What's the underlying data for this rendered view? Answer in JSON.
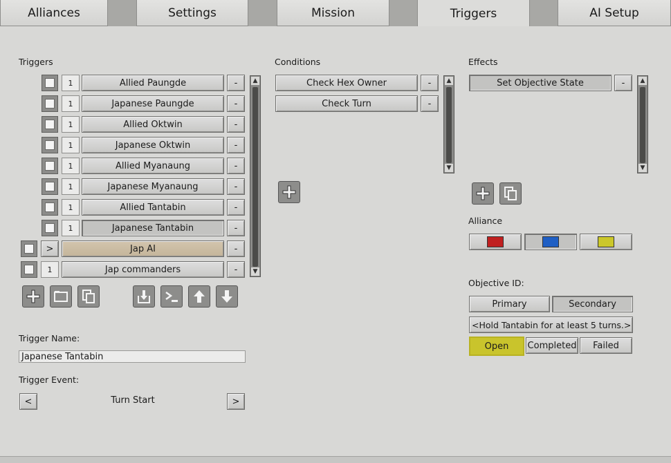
{
  "tabs": [
    {
      "label": "Alliances",
      "active": false
    },
    {
      "label": "Settings",
      "active": false
    },
    {
      "label": "Mission",
      "active": false
    },
    {
      "label": "Triggers",
      "active": true
    },
    {
      "label": "AI Setup",
      "active": false
    }
  ],
  "triggers": {
    "heading": "Triggers",
    "remove_label": "-",
    "items": [
      {
        "count": "1",
        "name": "Allied Paungde"
      },
      {
        "count": "1",
        "name": "Japanese Paungde"
      },
      {
        "count": "1",
        "name": "Allied Oktwin"
      },
      {
        "count": "1",
        "name": "Japanese Oktwin"
      },
      {
        "count": "1",
        "name": "Allied Myanaung"
      },
      {
        "count": "1",
        "name": "Japanese Myanaung"
      },
      {
        "count": "1",
        "name": "Allied Tantabin"
      },
      {
        "count": "1",
        "name": "Japanese Tantabin",
        "selected": true
      }
    ],
    "groups": [
      {
        "toggle": ">",
        "name": "Jap AI",
        "highlight": true
      },
      {
        "toggle": "1",
        "name": "Jap commanders"
      }
    ],
    "toolbar_icons": [
      "add-icon",
      "folder-icon",
      "copy-icon",
      "import-icon",
      "console-icon",
      "move-up-icon",
      "move-down-icon"
    ]
  },
  "trigger_name": {
    "label": "Trigger Name:",
    "value": "Japanese Tantabin"
  },
  "trigger_event": {
    "label": "Trigger Event:",
    "prev": "<",
    "value": "Turn Start",
    "next": ">"
  },
  "conditions": {
    "heading": "Conditions",
    "items": [
      "Check Hex Owner",
      "Check Turn"
    ],
    "remove_label": "-"
  },
  "effects": {
    "heading": "Effects",
    "items": [
      "Set Objective State"
    ],
    "remove_label": "-"
  },
  "alliance": {
    "heading": "Alliance",
    "colors": [
      "#c02020",
      "#1f5fc4",
      "#cbc72a"
    ],
    "selected_index": 1
  },
  "objective": {
    "heading": "Objective ID:",
    "types": [
      "Primary",
      "Secondary"
    ],
    "selected_type": "Secondary",
    "prev": "<",
    "next": ">",
    "text": "Hold Tantabin for at least 5 turns.",
    "states": [
      "Open",
      "Completed",
      "Failed"
    ],
    "selected_state": "Open",
    "highlight_color": "#c9c42c"
  },
  "scroll_arrows": {
    "up": "▲",
    "down": "▼"
  }
}
